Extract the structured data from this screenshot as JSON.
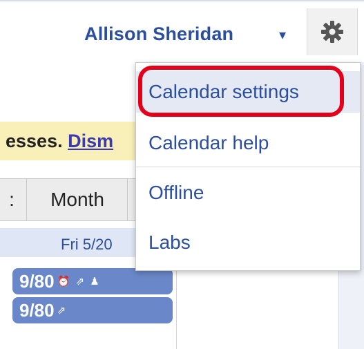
{
  "header": {
    "user_name": "Allison Sheridan",
    "caret": "▾"
  },
  "icons": {
    "gear": "gear-icon",
    "dropdown": "chevron-down-icon"
  },
  "notice": {
    "text_start": "esses. ",
    "link": "Dism"
  },
  "view_buttons": [
    {
      "label": ":"
    },
    {
      "label": "Month"
    }
  ],
  "calendar": {
    "day_label": "Fri 5/20",
    "events": [
      {
        "label": "9/80",
        "icons": "⏰ ⇗ ♟"
      },
      {
        "label": "9/80",
        "icons": "⇗"
      }
    ]
  },
  "settings_menu": {
    "items": [
      {
        "label": "Calendar settings"
      },
      {
        "label": "Calendar help"
      },
      {
        "label": "Offline"
      },
      {
        "label": "Labs"
      }
    ]
  },
  "colors": {
    "accent": "#2b4f9e",
    "highlight": "#e3001b",
    "event": "#6a88c9",
    "notice": "#f9efb8"
  }
}
